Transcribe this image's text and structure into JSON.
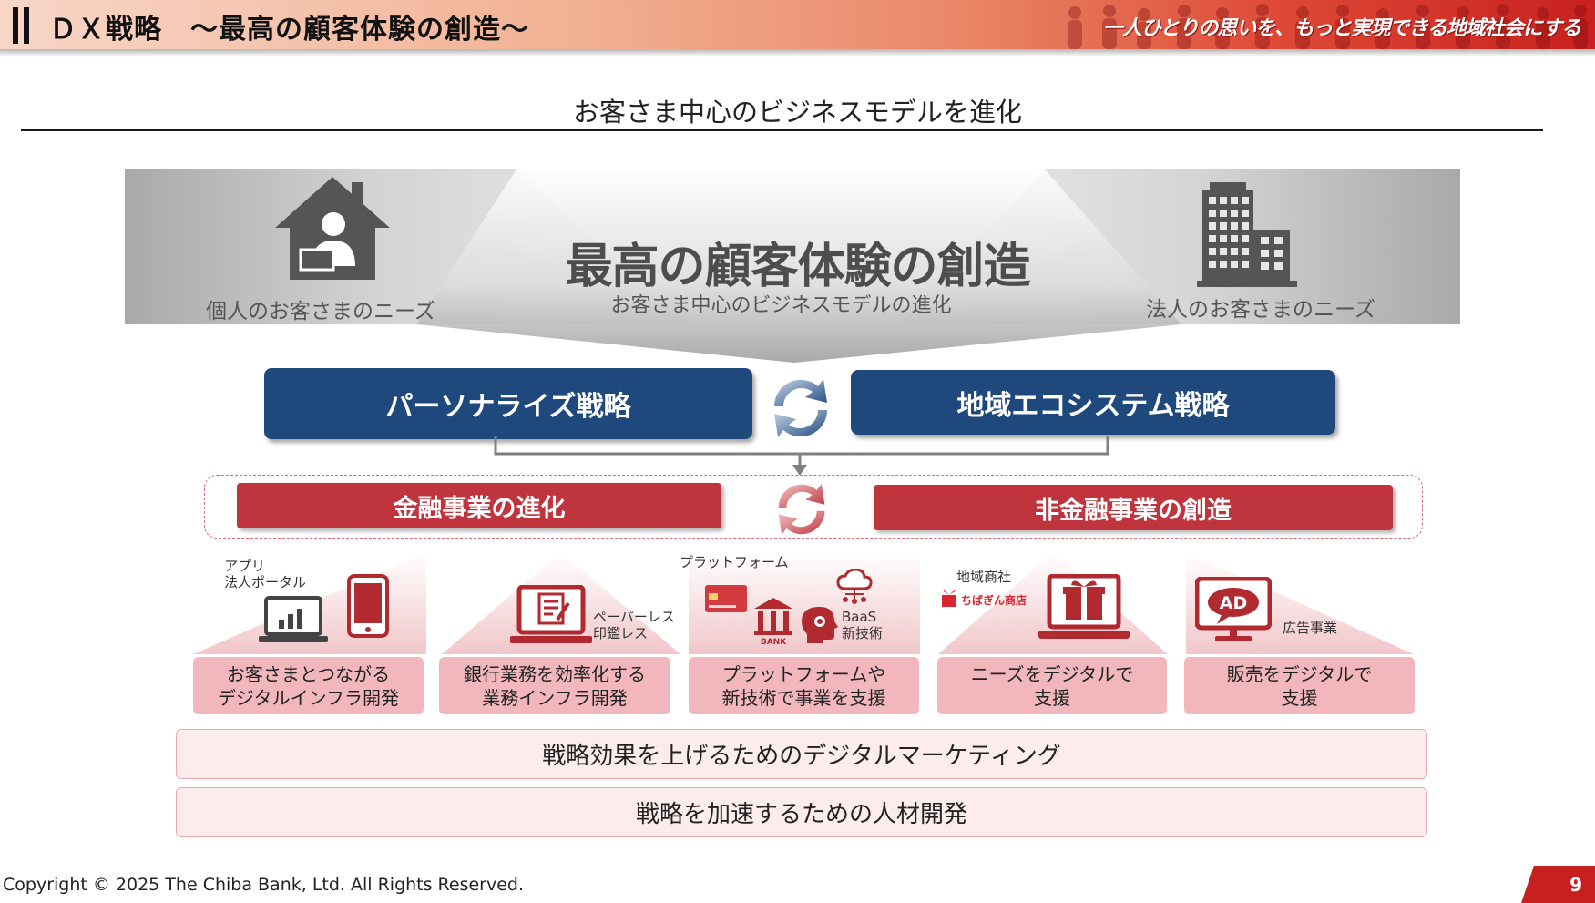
{
  "header": {
    "title": "ＤＸ戦略　～最高の顧客体験の創造～",
    "slogan": "一人ひとりの思いを、もっと実現できる地域社会にする"
  },
  "section_heading": "お客さま中心のビジネスモデルを進化",
  "banner": {
    "title": "最高の顧客体験の創造",
    "subtitle": "お客さま中心のビジネスモデルの進化",
    "left_needs": "個人のお客さまのニーズ",
    "right_needs": "法人のお客さまのニーズ"
  },
  "strategies": {
    "left": "パーソナライズ戦略",
    "right": "地域エコシステム戦略"
  },
  "business": {
    "left": "金融事業の進化",
    "right": "非金融事業の創造"
  },
  "pillars": [
    {
      "label": "お客さまとつながる\nデジタルインフラ開発",
      "note": "アプリ\n法人ポータル"
    },
    {
      "label": "銀行業務を効率化する\n業務インフラ開発",
      "note": "ペーパーレス\n印鑑レス"
    },
    {
      "label": "プラットフォームや\n新技術で事業を支援",
      "note": "プラットフォーム",
      "note2": "BaaS\n新技術",
      "bank_text": "BANK"
    },
    {
      "label": "ニーズをデジタルで\n支援",
      "note": "地域商社",
      "shop_name": "ちばぎん商店"
    },
    {
      "label": "販売をデジタルで\n支援",
      "note": "広告事業",
      "ad_text": "AD"
    }
  ],
  "bars": {
    "marketing": "戦略効果を上げるためのデジタルマーケティング",
    "hr": "戦略を加速するための人材開発"
  },
  "footer": {
    "copyright": "Copyright © 2025 The Chiba Bank, Ltd. All Rights Reserved.",
    "page_number": "9"
  },
  "colors": {
    "navy": "#1f497d",
    "red": "#c0353d",
    "pink": "#f2b7bc",
    "accent_red": "#c8201f"
  },
  "icons": [
    "house-person-icon",
    "office-building-icon",
    "cycle-arrows-icon",
    "laptop-chart-icon",
    "smartphone-icon",
    "laptop-document-icon",
    "credit-card-icon",
    "bank-icon",
    "cloud-network-icon",
    "brain-gear-icon",
    "gift-shop-icon",
    "laptop-gift-icon",
    "monitor-ad-icon"
  ]
}
